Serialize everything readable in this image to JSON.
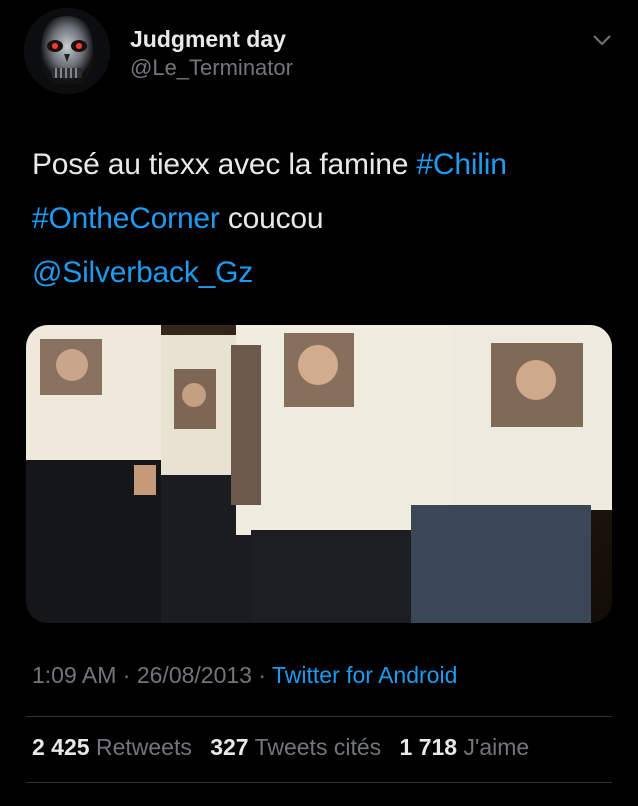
{
  "author": {
    "display_name": "Judgment day",
    "handle": "@Le_Terminator",
    "avatar_icon": "terminator-skull-avatar"
  },
  "tweet": {
    "text_plain_1": "Posé au tiexx avec la famine ",
    "hashtag_1": "#Chilin",
    "hashtag_2": "#OntheCorner",
    "text_plain_2": " coucou",
    "mention": "@Silverback_Gz"
  },
  "meta": {
    "time": "1:09 AM",
    "separator": " · ",
    "date": "26/08/2013",
    "source": "Twitter for Android"
  },
  "stats": {
    "retweets_count": "2 425",
    "retweets_label": "Retweets",
    "quotes_count": "327",
    "quotes_label": "Tweets cités",
    "likes_count": "1 718",
    "likes_label": "J'aime"
  },
  "colors": {
    "background": "#000000",
    "link": "#1d9bf0",
    "text": "#e7e9ea",
    "muted": "#71767b"
  }
}
